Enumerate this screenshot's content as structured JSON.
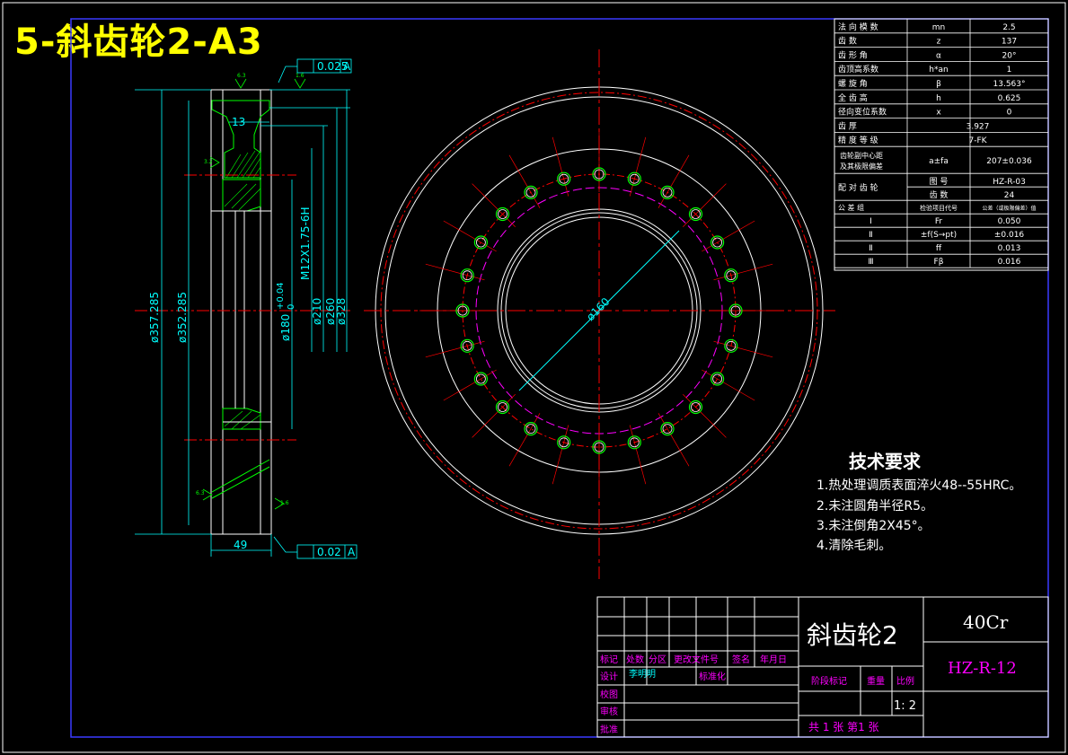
{
  "header_title": "5-斜齿轮2-A3",
  "params": [
    {
      "name": "法 向 模 数",
      "sym": "mn",
      "val": "2.5"
    },
    {
      "name": "齿 数",
      "sym": "z",
      "val": "137"
    },
    {
      "name": "齿 形 角",
      "sym": "α",
      "val": "20°"
    },
    {
      "name": "齿顶高系数",
      "sym": "h*an",
      "val": "1"
    },
    {
      "name": "螺 旋 角",
      "sym": "β",
      "val": "13.563°"
    },
    {
      "name": "全 齿 高",
      "sym": "h",
      "val": "0.625"
    },
    {
      "name": "径向变位系数",
      "sym": "x",
      "val": "0"
    },
    {
      "name": "齿 厚",
      "sym": "",
      "val": "3.927"
    },
    {
      "name": "精 度 等 级",
      "sym": "",
      "val": "7-FK"
    }
  ],
  "center_row": {
    "name1": "齿轮副中心距",
    "name2": "及其极限偏差",
    "sym": "a±fa",
    "val": "207±0.036"
  },
  "mate": {
    "label": "配 对 齿 轮",
    "r1_label": "图 号",
    "r1_val": "HZ-R-03",
    "r2_label": "齿 数",
    "r2_val": "24"
  },
  "tol_header": {
    "c1": "公 差 组",
    "c2": "检验项目代号",
    "c3": "公差（或极限偏差）值"
  },
  "tol_rows": [
    {
      "grp": "Ⅰ",
      "code": "Fr",
      "val": "0.050"
    },
    {
      "grp": "Ⅱ",
      "code": "±f(S→pt)",
      "val": "±0.016"
    },
    {
      "grp": "Ⅱ",
      "code": "ff",
      "val": "0.013"
    },
    {
      "grp": "Ⅲ",
      "code": "Fβ",
      "val": "0.016"
    }
  ],
  "tech": {
    "title": "技术要求",
    "items": [
      "1.热处理调质表面淬火48--55HRC。",
      "2.未注圆角半径R5。",
      "3.未注倒角2X45°。",
      "4.清除毛刺。"
    ]
  },
  "dims": {
    "d357": "ø357.285",
    "d352": "ø352.285",
    "d180": "ø180",
    "d180_tol_up": "+0.04",
    "d180_tol_lo": "0",
    "d210": "ø210",
    "d260": "ø260",
    "d328": "ø328",
    "thread": "M12X1.75-6H",
    "w13": "13",
    "w49": "49",
    "tol_top": "0.025",
    "tol_bot": "0.02",
    "datum": "A",
    "dia160": "ø160",
    "rough1": "6.3",
    "rough2": "1.6",
    "rough3": "6.3",
    "rough4": "1.6",
    "rough5": "3.2"
  },
  "title_block": {
    "part_name": "斜齿轮2",
    "material": "40Cr",
    "drawing_no": "HZ-R-12",
    "hdr": [
      "标记",
      "处数",
      "分区",
      "更改文件号",
      "签名",
      "年月日"
    ],
    "design": "设计",
    "designer": "李明明",
    "standard": "标准化",
    "check": "校图",
    "review": "审核",
    "approve": "批准",
    "stage_mark": "阶段标记",
    "weight": "重量",
    "scale_label": "比例",
    "scale": "1: 2",
    "sheets": "共 1 张 第1 张"
  },
  "colors": {
    "frame": "#3a3aff",
    "gear_red": "#ff0000",
    "green": "#00ff00",
    "cyan": "#00ffff",
    "magenta": "#ff00ff",
    "yellow": "#ffff00"
  }
}
